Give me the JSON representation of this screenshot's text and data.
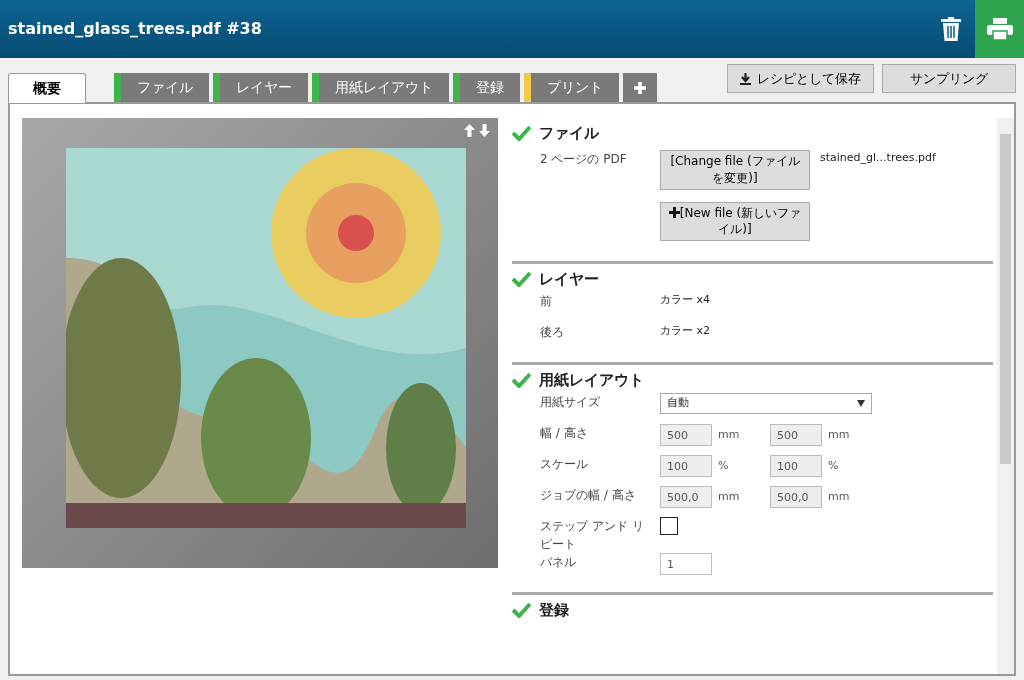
{
  "window": {
    "title": "stained_glass_trees.pdf #38"
  },
  "tabs": [
    {
      "label": "概要",
      "selected": true
    },
    {
      "label": "ファイル",
      "selected": false,
      "color": "#3cb54a"
    },
    {
      "label": "レイヤー",
      "selected": false,
      "color": "#3cb54a"
    },
    {
      "label": "用紙レイアウト",
      "selected": false,
      "color": "#3cb54a"
    },
    {
      "label": "登録",
      "selected": false,
      "color": "#3cb54a"
    },
    {
      "label": "プリント",
      "selected": false,
      "color": "#f2c94c"
    }
  ],
  "toolbar_buttons": [
    {
      "label": "レシピとして保存",
      "kind": "download"
    },
    {
      "label": "サンプリング",
      "kind": "plain"
    }
  ],
  "sections": [
    {
      "title": "ファイル",
      "complete": true,
      "rows": [
        {
          "kind": "file",
          "label": "2 ページの PDF",
          "buttons": [
            {
              "label": "[Change file (ファイルを変更)]",
              "kind": "plain"
            },
            {
              "label": "[New file (新しいファイル)]",
              "kind": "add"
            }
          ],
          "value": "stained_gl...trees.pdf"
        }
      ]
    },
    {
      "title": "レイヤー",
      "complete": true,
      "rows": [
        {
          "kind": "text",
          "label": "前",
          "value": "カラー x4"
        },
        {
          "kind": "text",
          "label": "後ろ",
          "value": "カラー x2"
        }
      ]
    },
    {
      "title": "用紙レイアウト",
      "complete": true,
      "rows": [
        {
          "kind": "select",
          "label": "用紙サイズ",
          "value": "自動"
        },
        {
          "kind": "pair",
          "label": "幅 / 高さ",
          "fields": [
            {
              "value": "500",
              "unit": "mm"
            },
            {
              "value": "500",
              "unit": "mm"
            }
          ]
        },
        {
          "kind": "pair",
          "label": "スケール",
          "fields": [
            {
              "value": "100",
              "unit": "%"
            },
            {
              "value": "100",
              "unit": "%"
            }
          ]
        },
        {
          "kind": "pair",
          "label": "ジョブの幅 / 高さ",
          "fields": [
            {
              "value": "500,0",
              "unit": "mm"
            },
            {
              "value": "500,0",
              "unit": "mm"
            }
          ]
        },
        {
          "kind": "checkbox",
          "label": "ステップ アンド リピート",
          "checked": false
        },
        {
          "kind": "input",
          "label": "パネル",
          "value": "1"
        }
      ]
    },
    {
      "title": "登録",
      "complete": true
    }
  ]
}
